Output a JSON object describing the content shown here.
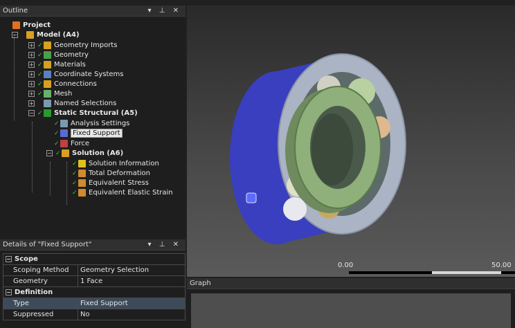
{
  "outline": {
    "title": "Outline",
    "controls": "▾ ⊥ ✕",
    "tree": {
      "project": "Project",
      "model": "Model (A4)",
      "geometry_imports": "Geometry Imports",
      "geometry": "Geometry",
      "materials": "Materials",
      "coordinate_systems": "Coordinate Systems",
      "connections": "Connections",
      "mesh": "Mesh",
      "named_selections": "Named Selections",
      "static_structural": "Static Structural (A5)",
      "analysis_settings": "Analysis Settings",
      "fixed_support": "Fixed Support",
      "force": "Force",
      "solution": "Solution (A6)",
      "solution_information": "Solution Information",
      "total_deformation": "Total Deformation",
      "equivalent_stress": "Equivalent Stress",
      "equivalent_elastic_strain": "Equivalent Elastic Strain"
    }
  },
  "details": {
    "title": "Details of \"Fixed Support\"",
    "controls": "▾ ⊥ ✕",
    "scope_label": "Scope",
    "scoping_method_label": "Scoping Method",
    "scoping_method_value": "Geometry Selection",
    "geometry_label": "Geometry",
    "geometry_value": "1 Face",
    "definition_label": "Definition",
    "type_label": "Type",
    "type_value": "Fixed Support",
    "suppressed_label": "Suppressed",
    "suppressed_value": "No"
  },
  "viewport": {
    "scale_left": "0.00",
    "scale_right": "50.00"
  },
  "graph": {
    "title": "Graph"
  },
  "colors": {
    "outer_ring_side": "#3a3fbf",
    "outer_ring_face": "#aab4c4",
    "inner_ring": "#8fb07a",
    "balls": "#c8c8b0",
    "selection_marker": "#5b6cff"
  }
}
